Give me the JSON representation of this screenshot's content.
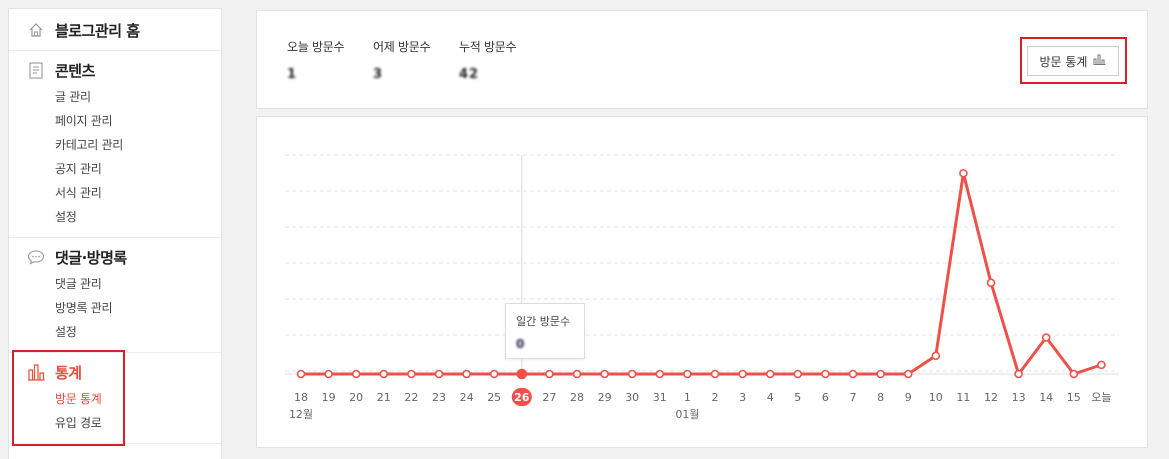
{
  "sidebar": {
    "home": {
      "label": "블로그관리 홈",
      "icon": "home-icon"
    },
    "contents": {
      "label": "콘텐츠",
      "icon": "document-icon",
      "items": [
        "글 관리",
        "페이지 관리",
        "카테고리 관리",
        "공지 관리",
        "서식 관리",
        "설정"
      ]
    },
    "comments": {
      "label": "댓글·방명록",
      "icon": "speech-bubble-icon",
      "items": [
        "댓글 관리",
        "방명록 관리",
        "설정"
      ]
    },
    "stats": {
      "label": "통계",
      "icon": "bar-chart-icon",
      "items": [
        "방문 통계",
        "유입 경로"
      ],
      "selected": "방문 통계"
    }
  },
  "summary": {
    "today_label": "오늘 방문수",
    "today_value": "1",
    "yesterday_label": "어제 방문수",
    "yesterday_value": "3",
    "total_label": "누적 방문수",
    "total_value": "42",
    "button_label": "방문 통계",
    "button_icon": "bar-chart-icon"
  },
  "tooltip": {
    "label": "일간 방문수",
    "value": "0"
  },
  "colors": {
    "accent": "#f0504a",
    "highlight_box": "#d6202a"
  },
  "chart_data": {
    "type": "line",
    "x": [
      "18",
      "19",
      "20",
      "21",
      "22",
      "23",
      "24",
      "25",
      "26",
      "27",
      "28",
      "29",
      "30",
      "31",
      "1",
      "2",
      "3",
      "4",
      "5",
      "6",
      "7",
      "8",
      "9",
      "10",
      "11",
      "12",
      "13",
      "14",
      "15",
      "오늘"
    ],
    "month_labels": [
      {
        "at": "18",
        "text": "12월"
      },
      {
        "at": "1",
        "text": "01월"
      }
    ],
    "series": [
      {
        "values": [
          0,
          0,
          0,
          0,
          0,
          0,
          0,
          0,
          0,
          0,
          0,
          0,
          0,
          0,
          0,
          0,
          0,
          0,
          0,
          0,
          0,
          0,
          0,
          1,
          11,
          5,
          0,
          2,
          0,
          0.5
        ]
      }
    ],
    "highlight": "26",
    "grid": "horizontal dashed",
    "ylim": [
      0,
      12
    ]
  }
}
